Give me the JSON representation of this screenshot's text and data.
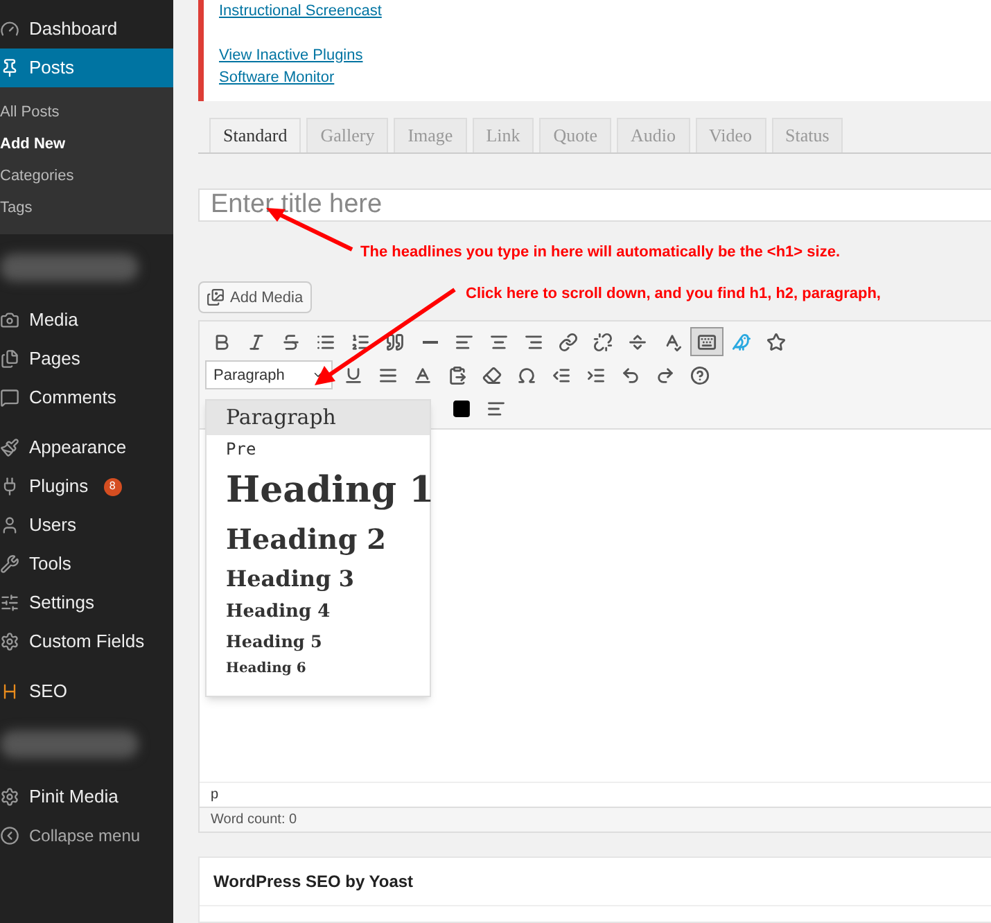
{
  "sidebar": {
    "items": [
      {
        "kind": "item",
        "label": "Dashboard",
        "selected": false
      },
      {
        "kind": "item",
        "label": "Posts",
        "selected": true,
        "children": [
          {
            "label": "All Posts",
            "selected": false
          },
          {
            "label": "Add New",
            "selected": true
          },
          {
            "label": "Categories",
            "selected": false
          },
          {
            "label": "Tags",
            "selected": false
          }
        ]
      },
      {
        "kind": "blurred"
      },
      {
        "kind": "item",
        "label": "Media",
        "selected": false
      },
      {
        "kind": "item",
        "label": "Pages",
        "selected": false
      },
      {
        "kind": "item",
        "label": "Comments",
        "selected": false
      },
      {
        "kind": "gap"
      },
      {
        "kind": "item",
        "label": "Appearance",
        "selected": false
      },
      {
        "kind": "item",
        "label": "Plugins",
        "selected": false,
        "badge": "8"
      },
      {
        "kind": "item",
        "label": "Users",
        "selected": false
      },
      {
        "kind": "item",
        "label": "Tools",
        "selected": false
      },
      {
        "kind": "item",
        "label": "Settings",
        "selected": false
      },
      {
        "kind": "item",
        "label": "Custom Fields",
        "selected": false
      },
      {
        "kind": "gap"
      },
      {
        "kind": "item",
        "label": "SEO",
        "selected": false
      },
      {
        "kind": "blurred"
      },
      {
        "kind": "item",
        "label": "Pinit Media",
        "selected": false
      },
      {
        "kind": "collapse",
        "label": "Collapse menu",
        "selected": false
      }
    ]
  },
  "notice": {
    "links": [
      "Instructional Screencast",
      "View Inactive Plugins",
      "Software Monitor"
    ]
  },
  "format_tabs": [
    {
      "label": "Standard",
      "selected": true
    },
    {
      "label": "Gallery",
      "selected": false
    },
    {
      "label": "Image",
      "selected": false
    },
    {
      "label": "Link",
      "selected": false
    },
    {
      "label": "Quote",
      "selected": false
    },
    {
      "label": "Audio",
      "selected": false
    },
    {
      "label": "Video",
      "selected": false
    },
    {
      "label": "Status",
      "selected": false
    }
  ],
  "title_field": {
    "placeholder": "Enter title here"
  },
  "add_media": "Add Media",
  "editor": {
    "toolbar_1": [
      {
        "active": false
      },
      {
        "active": false
      },
      {
        "active": false
      },
      {
        "active": false
      },
      {
        "active": false
      },
      {
        "active": false
      },
      {
        "active": false
      },
      {
        "active": false
      },
      {
        "active": false
      },
      {
        "active": false
      },
      {
        "active": false
      },
      {
        "active": false
      },
      {
        "active": false
      },
      {
        "active": false
      },
      {
        "active": true
      },
      {
        "active": false
      },
      {
        "active": false
      }
    ],
    "format_select": {
      "value": "Paragraph",
      "expanded": true
    },
    "format_options": [
      {
        "kind": "p",
        "label": "Paragraph",
        "selected": true
      },
      {
        "kind": "pre",
        "label": "Pre",
        "selected": false
      },
      {
        "kind": "h1",
        "label": "Heading 1",
        "selected": false
      },
      {
        "kind": "h2",
        "label": "Heading 2",
        "selected": false
      },
      {
        "kind": "h3",
        "label": "Heading 3",
        "selected": false
      },
      {
        "kind": "h4",
        "label": "Heading 4",
        "selected": false
      },
      {
        "kind": "h5",
        "label": "Heading 5",
        "selected": false
      },
      {
        "kind": "h6",
        "label": "Heading 6",
        "selected": false
      }
    ],
    "path": "p",
    "word_count": "Word count: 0"
  },
  "annotations": [
    "The headlines you type in here will automatically be the <h1> size.",
    "Click here to scroll down, and you find h1, h2, paragraph,"
  ],
  "seo_box": {
    "title": "WordPress SEO by Yoast"
  }
}
